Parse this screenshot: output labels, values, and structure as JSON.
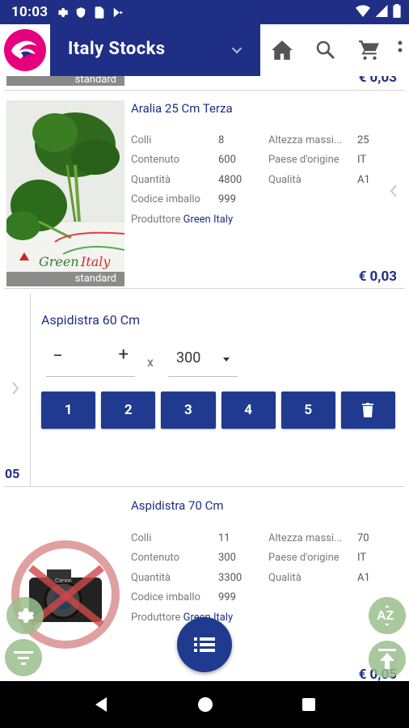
{
  "status_bar": {
    "time": "10:03",
    "left_icons": [
      "gear-icon",
      "shield-icon",
      "sim-icon",
      "play-store-icon"
    ],
    "right_icons": [
      "wifi-icon",
      "signal-icon",
      "battery-icon"
    ]
  },
  "app_bar": {
    "title": "Italy Stocks",
    "actions": [
      "home-icon",
      "search-icon",
      "cart-icon",
      "more-icon"
    ]
  },
  "partial_item": {
    "image_label": "standard",
    "price": "€ 0,03"
  },
  "products": [
    {
      "title": "Aralia 25 Cm Terza",
      "image_label": "standard",
      "specs_left": [
        {
          "label": "Colli",
          "value": "8"
        },
        {
          "label": "Contenuto",
          "value": "600"
        },
        {
          "label": "Quantità",
          "value": "4800"
        },
        {
          "label": "Codice imballo",
          "value": "999"
        }
      ],
      "specs_right": [
        {
          "label": "Altezza massi...",
          "value": "25"
        },
        {
          "label": "Paese d'origine",
          "value": "IT"
        },
        {
          "label": "Qualità",
          "value": "A1"
        }
      ],
      "producer_label": "Produttore",
      "producer": "Green Italy",
      "price": "€ 0,03"
    },
    {
      "title": "Aspidistra 70 Cm",
      "specs_left": [
        {
          "label": "Colli",
          "value": "11"
        },
        {
          "label": "Contenuto",
          "value": "300"
        },
        {
          "label": "Quantità",
          "value": "3300"
        },
        {
          "label": "Codice imballo",
          "value": "999"
        }
      ],
      "specs_right": [
        {
          "label": "Altezza massi...",
          "value": "70"
        },
        {
          "label": "Paese d'origine",
          "value": "IT"
        },
        {
          "label": "Qualità",
          "value": "A1"
        }
      ],
      "producer_label": "Produttore",
      "producer": "Green Italy",
      "price": "€ 0,05"
    }
  ],
  "expanded_item": {
    "index": "05",
    "title": "Aspidistra 60 Cm",
    "minus": "−",
    "plus": "+",
    "times": "x",
    "quantity": "300",
    "buttons": [
      "1",
      "2",
      "3",
      "4",
      "5"
    ]
  },
  "colors": {
    "primary": "#1f2f86",
    "button": "#1f3a8f",
    "fab_secondary": "#9abe8c",
    "divider": "#d4d4d4"
  }
}
